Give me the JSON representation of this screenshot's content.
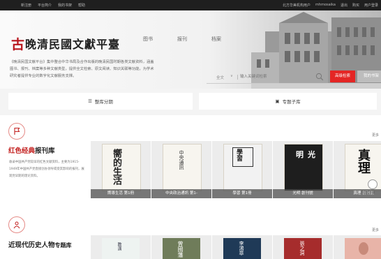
{
  "topbar": {
    "left_links": [
      "新注册",
      "平台简介",
      "我的书架",
      "帮助"
    ],
    "right_links": [
      "北方华美机构用户",
      "mhmosaika",
      "退出",
      "购买",
      "用户登录"
    ]
  },
  "header": {
    "logo_mark": "古",
    "title": "晚清民國文獻平臺",
    "nav": [
      "图书",
      "报刊",
      "档案"
    ],
    "intro": "《晚清民国文献平台》集中整合中华书局及合作出版的晚清民国时期各类文献资料，涵盖图书、报刊、档案等多种文献类型，提供全文检索、原文阅读、知识关联等功能，为学术研究者提供专业的数字化文献服务支撑。"
  },
  "search": {
    "scope": "全文",
    "placeholder": "输入关键词检索",
    "search_button": "高级检索",
    "my_search_button": "我的书架"
  },
  "tabs": {
    "tab1": "整库分期",
    "tab2": "专题子库"
  },
  "section1": {
    "title_red": "红色经典",
    "title_black": "报刊库",
    "more": "更多",
    "description": "收录中国共产党较早的红色文献资料，主要为1915-1949年中国共产党直接创办领导或受其影响的报刊，展现党早期的理论资料。",
    "cards": [
      {
        "caption": "嚮導生活 第1冊",
        "cover_text": "嚮的生活"
      },
      {
        "caption": "中央政治通訊 第1-",
        "cover_text": "中央通訊"
      },
      {
        "caption": "學習 第1冊",
        "cover_text": "學習"
      },
      {
        "caption": "光明 創刊號",
        "cover_text": "明光"
      },
      {
        "caption": "真理 創刊號",
        "cover_text": "真理"
      }
    ]
  },
  "section2": {
    "title": "近现代历史人物",
    "title_line2": "专题库",
    "more": "更多",
    "cards": [
      {
        "cover_text": "教演"
      },
      {
        "cover_text": "曾國藩"
      },
      {
        "cover_text": "李鴻章"
      },
      {
        "cover_text": "張之洞"
      },
      {
        "cover_text": ""
      }
    ]
  },
  "float": {
    "label": "回到顶部"
  },
  "colors": {
    "accent": "#e42625",
    "topbar": "#1f1f1f"
  }
}
